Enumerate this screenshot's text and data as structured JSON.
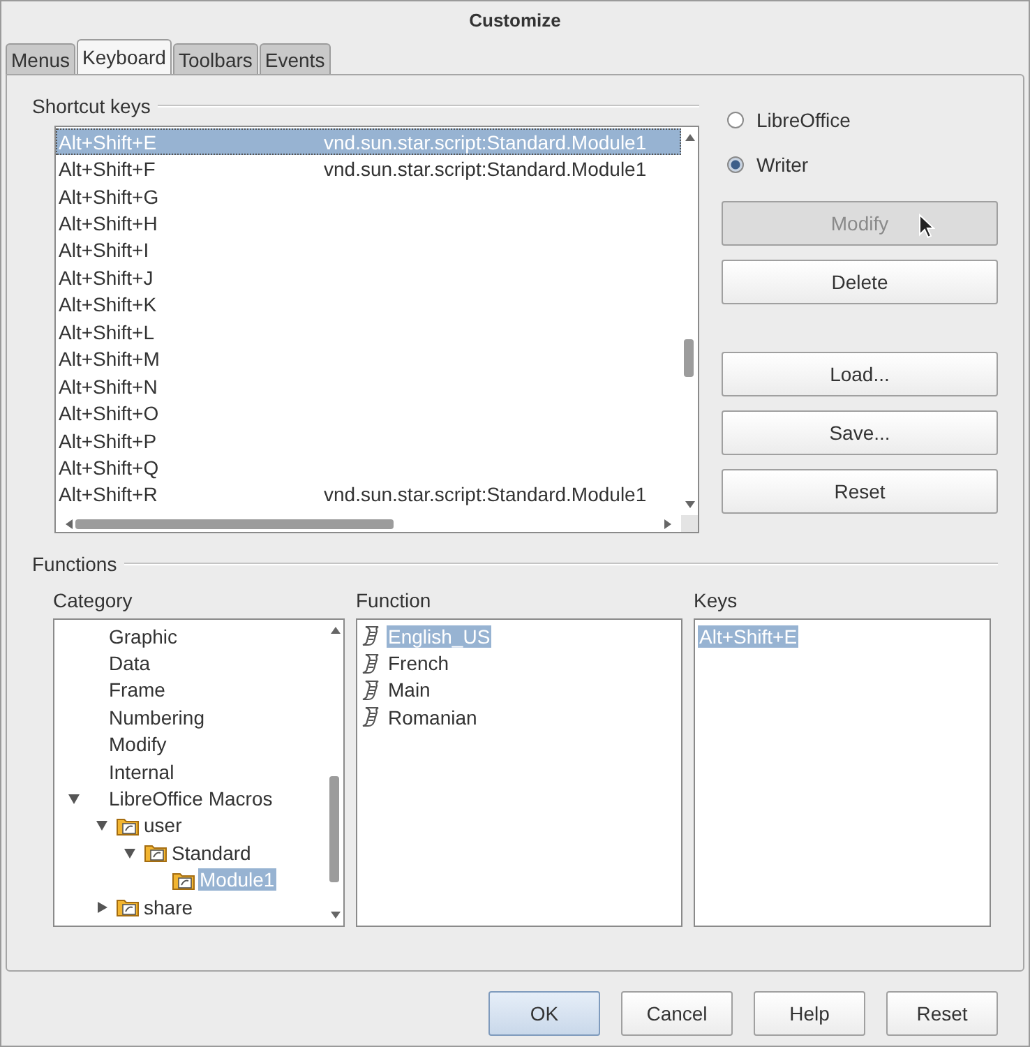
{
  "window": {
    "title": "Customize"
  },
  "tabs": [
    {
      "label": "Menus",
      "selected": false
    },
    {
      "label": "Keyboard",
      "selected": true
    },
    {
      "label": "Toolbars",
      "selected": false
    },
    {
      "label": "Events",
      "selected": false
    }
  ],
  "shortcut_keys": {
    "title": "Shortcut keys",
    "rows": [
      {
        "key": "Alt+Shift+E",
        "command": "vnd.sun.star.script:Standard.Module1",
        "selected": true
      },
      {
        "key": "Alt+Shift+F",
        "command": "vnd.sun.star.script:Standard.Module1",
        "selected": false
      },
      {
        "key": "Alt+Shift+G",
        "selected": false
      },
      {
        "key": "Alt+Shift+H",
        "selected": false
      },
      {
        "key": "Alt+Shift+I",
        "selected": false
      },
      {
        "key": "Alt+Shift+J",
        "selected": false
      },
      {
        "key": "Alt+Shift+K",
        "selected": false
      },
      {
        "key": "Alt+Shift+L",
        "selected": false
      },
      {
        "key": "Alt+Shift+M",
        "selected": false
      },
      {
        "key": "Alt+Shift+N",
        "selected": false
      },
      {
        "key": "Alt+Shift+O",
        "selected": false
      },
      {
        "key": "Alt+Shift+P",
        "selected": false
      },
      {
        "key": "Alt+Shift+Q",
        "selected": false
      },
      {
        "key": "Alt+Shift+R",
        "command": "vnd.sun.star.script:Standard.Module1",
        "selected": false
      }
    ]
  },
  "scope": [
    {
      "label": "LibreOffice",
      "selected": false
    },
    {
      "label": "Writer",
      "selected": true
    }
  ],
  "edit_buttons": [
    {
      "label": "Modify",
      "disabled": true
    },
    {
      "label": "Delete",
      "disabled": false
    }
  ],
  "file_buttons": [
    {
      "label": "Load...",
      "disabled": false
    },
    {
      "label": "Save...",
      "disabled": false
    },
    {
      "label": "Reset",
      "disabled": false
    }
  ],
  "functions": {
    "title": "Functions",
    "category": {
      "label": "Category",
      "tree": [
        {
          "label": "Graphic",
          "kind": "category",
          "selected": false
        },
        {
          "label": "Data",
          "kind": "category",
          "selected": false
        },
        {
          "label": "Frame",
          "kind": "category",
          "selected": false
        },
        {
          "label": "Numbering",
          "kind": "category",
          "selected": false
        },
        {
          "label": "Modify",
          "kind": "category",
          "selected": false
        },
        {
          "label": "Internal",
          "kind": "category",
          "selected": false
        },
        {
          "label": "LibreOffice Macros",
          "kind": "category",
          "selected": false,
          "expanded": true,
          "children": [
            {
              "label": "user",
              "kind": "library",
              "selected": false,
              "expanded": true,
              "children": [
                {
                  "label": "Standard",
                  "kind": "library",
                  "selected": false,
                  "expanded": true,
                  "children": [
                    {
                      "label": "Module1",
                      "kind": "library",
                      "selected": true
                    }
                  ]
                }
              ]
            },
            {
              "label": "share",
              "kind": "library",
              "selected": false,
              "expanded": false
            }
          ]
        }
      ]
    },
    "function": {
      "label": "Function",
      "items": [
        {
          "label": "English_US",
          "selected": true
        },
        {
          "label": "French",
          "selected": false
        },
        {
          "label": "Main",
          "selected": false
        },
        {
          "label": "Romanian",
          "selected": false
        }
      ]
    },
    "keys": {
      "label": "Keys",
      "items": [
        {
          "label": "Alt+Shift+E",
          "selected": true
        }
      ]
    }
  },
  "dialog_buttons": [
    {
      "label": "OK",
      "default": true
    },
    {
      "label": "Cancel",
      "default": false
    },
    {
      "label": "Help",
      "default": false
    },
    {
      "label": "Reset",
      "default": false
    }
  ]
}
